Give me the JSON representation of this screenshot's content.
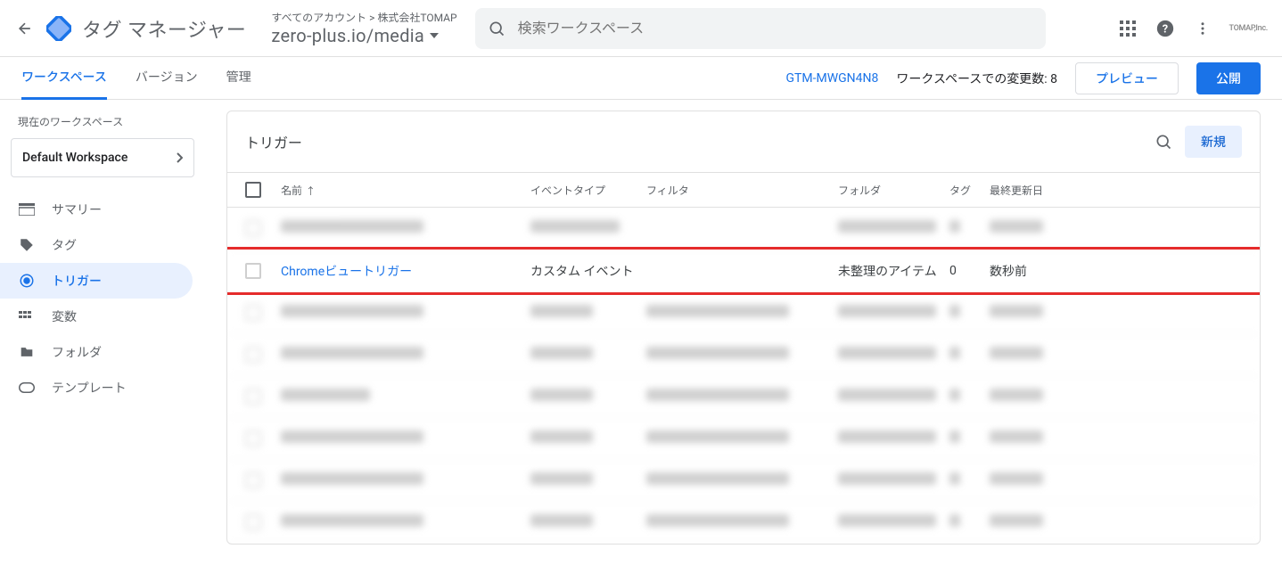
{
  "header": {
    "app_title": "タグ マネージャー",
    "breadcrumb": "すべてのアカウント > 株式会社TOMAP",
    "container_name": "zero-plus.io/media",
    "search_placeholder": "検索ワークスペース",
    "company_label": "TOMAP,Inc."
  },
  "subheader": {
    "tabs": [
      {
        "label": "ワークスペース",
        "active": true
      },
      {
        "label": "バージョン",
        "active": false
      },
      {
        "label": "管理",
        "active": false
      }
    ],
    "gtm_id": "GTM-MWGN4N8",
    "changes_text": "ワークスペースでの変更数: 8",
    "preview_label": "プレビュー",
    "publish_label": "公開"
  },
  "sidebar": {
    "current_ws_label": "現在のワークスペース",
    "workspace_name": "Default Workspace",
    "nav": [
      {
        "label": "サマリー"
      },
      {
        "label": "タグ"
      },
      {
        "label": "トリガー"
      },
      {
        "label": "変数"
      },
      {
        "label": "フォルダ"
      },
      {
        "label": "テンプレート"
      }
    ]
  },
  "main": {
    "card_title": "トリガー",
    "new_button": "新規",
    "columns": {
      "name": "名前",
      "event_type": "イベントタイプ",
      "filter": "フィルタ",
      "folder": "フォルダ",
      "tags": "タグ",
      "updated": "最終更新日"
    },
    "highlighted_row": {
      "name": "Chromeビュートリガー",
      "event_type": "カスタム イベント",
      "filter": "",
      "folder": "未整理のアイテム",
      "tags": "0",
      "updated": "数秒前"
    }
  }
}
